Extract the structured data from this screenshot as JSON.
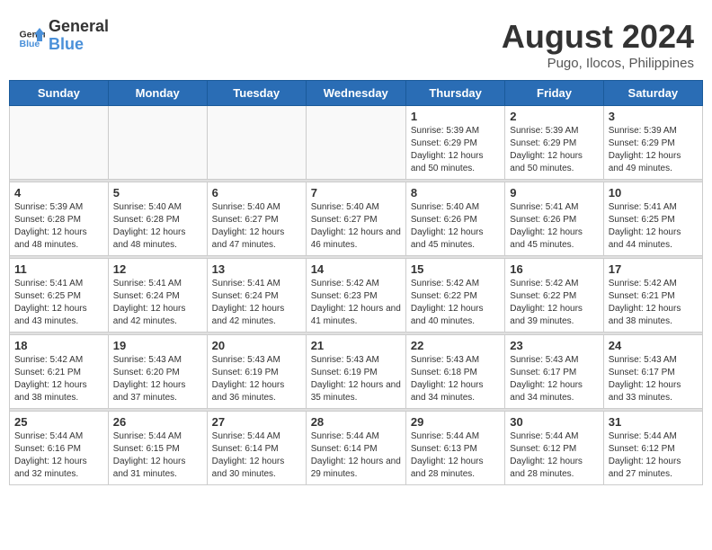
{
  "header": {
    "logo_line1": "General",
    "logo_line2": "Blue",
    "month_year": "August 2024",
    "location": "Pugo, Ilocos, Philippines"
  },
  "weekdays": [
    "Sunday",
    "Monday",
    "Tuesday",
    "Wednesday",
    "Thursday",
    "Friday",
    "Saturday"
  ],
  "weeks": [
    [
      {
        "day": "",
        "info": ""
      },
      {
        "day": "",
        "info": ""
      },
      {
        "day": "",
        "info": ""
      },
      {
        "day": "",
        "info": ""
      },
      {
        "day": "1",
        "info": "Sunrise: 5:39 AM\nSunset: 6:29 PM\nDaylight: 12 hours\nand 50 minutes."
      },
      {
        "day": "2",
        "info": "Sunrise: 5:39 AM\nSunset: 6:29 PM\nDaylight: 12 hours\nand 50 minutes."
      },
      {
        "day": "3",
        "info": "Sunrise: 5:39 AM\nSunset: 6:29 PM\nDaylight: 12 hours\nand 49 minutes."
      }
    ],
    [
      {
        "day": "4",
        "info": "Sunrise: 5:39 AM\nSunset: 6:28 PM\nDaylight: 12 hours\nand 48 minutes."
      },
      {
        "day": "5",
        "info": "Sunrise: 5:40 AM\nSunset: 6:28 PM\nDaylight: 12 hours\nand 48 minutes."
      },
      {
        "day": "6",
        "info": "Sunrise: 5:40 AM\nSunset: 6:27 PM\nDaylight: 12 hours\nand 47 minutes."
      },
      {
        "day": "7",
        "info": "Sunrise: 5:40 AM\nSunset: 6:27 PM\nDaylight: 12 hours\nand 46 minutes."
      },
      {
        "day": "8",
        "info": "Sunrise: 5:40 AM\nSunset: 6:26 PM\nDaylight: 12 hours\nand 45 minutes."
      },
      {
        "day": "9",
        "info": "Sunrise: 5:41 AM\nSunset: 6:26 PM\nDaylight: 12 hours\nand 45 minutes."
      },
      {
        "day": "10",
        "info": "Sunrise: 5:41 AM\nSunset: 6:25 PM\nDaylight: 12 hours\nand 44 minutes."
      }
    ],
    [
      {
        "day": "11",
        "info": "Sunrise: 5:41 AM\nSunset: 6:25 PM\nDaylight: 12 hours\nand 43 minutes."
      },
      {
        "day": "12",
        "info": "Sunrise: 5:41 AM\nSunset: 6:24 PM\nDaylight: 12 hours\nand 42 minutes."
      },
      {
        "day": "13",
        "info": "Sunrise: 5:41 AM\nSunset: 6:24 PM\nDaylight: 12 hours\nand 42 minutes."
      },
      {
        "day": "14",
        "info": "Sunrise: 5:42 AM\nSunset: 6:23 PM\nDaylight: 12 hours\nand 41 minutes."
      },
      {
        "day": "15",
        "info": "Sunrise: 5:42 AM\nSunset: 6:22 PM\nDaylight: 12 hours\nand 40 minutes."
      },
      {
        "day": "16",
        "info": "Sunrise: 5:42 AM\nSunset: 6:22 PM\nDaylight: 12 hours\nand 39 minutes."
      },
      {
        "day": "17",
        "info": "Sunrise: 5:42 AM\nSunset: 6:21 PM\nDaylight: 12 hours\nand 38 minutes."
      }
    ],
    [
      {
        "day": "18",
        "info": "Sunrise: 5:42 AM\nSunset: 6:21 PM\nDaylight: 12 hours\nand 38 minutes."
      },
      {
        "day": "19",
        "info": "Sunrise: 5:43 AM\nSunset: 6:20 PM\nDaylight: 12 hours\nand 37 minutes."
      },
      {
        "day": "20",
        "info": "Sunrise: 5:43 AM\nSunset: 6:19 PM\nDaylight: 12 hours\nand 36 minutes."
      },
      {
        "day": "21",
        "info": "Sunrise: 5:43 AM\nSunset: 6:19 PM\nDaylight: 12 hours\nand 35 minutes."
      },
      {
        "day": "22",
        "info": "Sunrise: 5:43 AM\nSunset: 6:18 PM\nDaylight: 12 hours\nand 34 minutes."
      },
      {
        "day": "23",
        "info": "Sunrise: 5:43 AM\nSunset: 6:17 PM\nDaylight: 12 hours\nand 34 minutes."
      },
      {
        "day": "24",
        "info": "Sunrise: 5:43 AM\nSunset: 6:17 PM\nDaylight: 12 hours\nand 33 minutes."
      }
    ],
    [
      {
        "day": "25",
        "info": "Sunrise: 5:44 AM\nSunset: 6:16 PM\nDaylight: 12 hours\nand 32 minutes."
      },
      {
        "day": "26",
        "info": "Sunrise: 5:44 AM\nSunset: 6:15 PM\nDaylight: 12 hours\nand 31 minutes."
      },
      {
        "day": "27",
        "info": "Sunrise: 5:44 AM\nSunset: 6:14 PM\nDaylight: 12 hours\nand 30 minutes."
      },
      {
        "day": "28",
        "info": "Sunrise: 5:44 AM\nSunset: 6:14 PM\nDaylight: 12 hours\nand 29 minutes."
      },
      {
        "day": "29",
        "info": "Sunrise: 5:44 AM\nSunset: 6:13 PM\nDaylight: 12 hours\nand 28 minutes."
      },
      {
        "day": "30",
        "info": "Sunrise: 5:44 AM\nSunset: 6:12 PM\nDaylight: 12 hours\nand 28 minutes."
      },
      {
        "day": "31",
        "info": "Sunrise: 5:44 AM\nSunset: 6:12 PM\nDaylight: 12 hours\nand 27 minutes."
      }
    ]
  ]
}
